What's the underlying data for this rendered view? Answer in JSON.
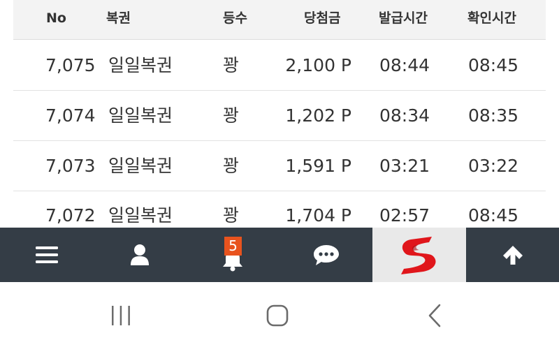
{
  "table": {
    "headers": {
      "no": "No",
      "name": "복권",
      "rank": "등수",
      "prize": "당첨금",
      "issue_time": "발급시간",
      "check_time": "확인시간"
    },
    "rows": [
      {
        "no": "7,075",
        "name": "일일복권",
        "rank": "꽝",
        "prize": "2,100 P",
        "issue_time": "08:44",
        "check_time": "08:45"
      },
      {
        "no": "7,074",
        "name": "일일복권",
        "rank": "꽝",
        "prize": "1,202 P",
        "issue_time": "08:34",
        "check_time": "08:35"
      },
      {
        "no": "7,073",
        "name": "일일복권",
        "rank": "꽝",
        "prize": "1,591 P",
        "issue_time": "03:21",
        "check_time": "03:22"
      },
      {
        "no": "7,072",
        "name": "일일복권",
        "rank": "꽝",
        "prize": "1,704 P",
        "issue_time": "02:57",
        "check_time": "08:45"
      }
    ]
  },
  "bottom_bar": {
    "notification_count": "5",
    "icons": [
      "menu-icon",
      "user-icon",
      "bell-icon",
      "chat-icon",
      "site-logo",
      "arrow-up-icon"
    ],
    "background": "#343d46",
    "badge_color": "#e8531e",
    "logo_color": "#e0161b"
  },
  "system_nav": {
    "icons": [
      "recents-icon",
      "home-icon",
      "back-icon"
    ]
  }
}
